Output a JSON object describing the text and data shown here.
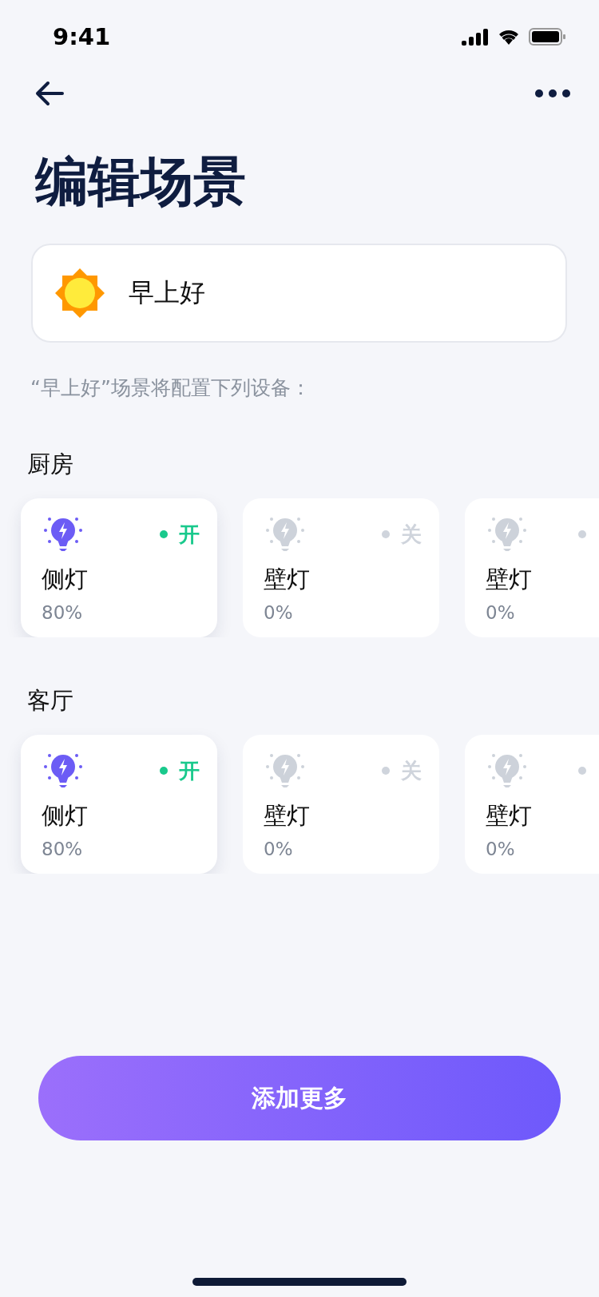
{
  "status_bar": {
    "time": "9:41"
  },
  "title": "编辑场景",
  "scene": {
    "value": "早上好"
  },
  "caption": "“早上好”场景将配置下列设备：",
  "rooms": [
    {
      "name": "厨房",
      "devices": [
        {
          "name": "侧灯",
          "level_text": "80%",
          "on": true,
          "status": "开"
        },
        {
          "name": "壁灯",
          "level_text": "0%",
          "on": false,
          "status": "关"
        },
        {
          "name": "壁灯",
          "level_text": "0%",
          "on": false
        }
      ]
    },
    {
      "name": "客厅",
      "devices": [
        {
          "name": "侧灯",
          "level_text": "80%",
          "on": true,
          "status": "开"
        },
        {
          "name": "壁灯",
          "level_text": "0%",
          "on": false,
          "status": "关"
        },
        {
          "name": "壁灯",
          "level_text": "0%",
          "on": false
        }
      ]
    }
  ],
  "add_button": "添加更多"
}
